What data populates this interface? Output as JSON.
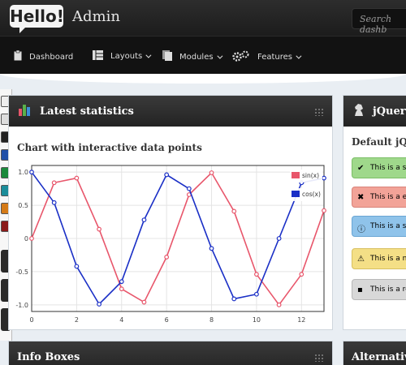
{
  "header": {
    "logo_text": "Hello!",
    "app_name": "Admin",
    "search_placeholder": "Search dashb"
  },
  "nav": {
    "items": [
      {
        "label": "Dashboard",
        "icon": "clipboard-icon"
      },
      {
        "label": "Layouts",
        "icon": "layout-icon"
      },
      {
        "label": "Modules",
        "icon": "pages-icon"
      },
      {
        "label": "Features",
        "icon": "gears-icon"
      }
    ]
  },
  "widgets": {
    "stats": {
      "title": "Latest statistics",
      "icon": "bar-chart-icon"
    },
    "jquery": {
      "title": "jQuery",
      "icon": "chess-knight-icon",
      "subtitle": "Default jQu"
    },
    "infoboxes": {
      "title": "Info Boxes"
    },
    "alternative": {
      "title": "Alternative w"
    }
  },
  "alerts": [
    {
      "text": "This is a su",
      "type": "success",
      "color": "#9fd88b"
    },
    {
      "text": "This is a er",
      "type": "error",
      "color": "#f2a398"
    },
    {
      "text": "This is a sy",
      "type": "info",
      "color": "#8fc3ea"
    },
    {
      "text": "This is a n",
      "type": "notice",
      "color": "#f4df86"
    },
    {
      "text": "This is a re",
      "type": "neutral",
      "color": "#d8d8d8"
    }
  ],
  "chart_data": {
    "type": "line",
    "title": "Chart with interactive data points",
    "xlim": [
      0,
      13
    ],
    "ylim": [
      -1.1,
      1.1
    ],
    "x_ticks": [
      "0",
      "2",
      "4",
      "6",
      "8",
      "10",
      "12"
    ],
    "y_ticks": [
      "1.0",
      "0.5",
      "0",
      "-0.5",
      "-1.0"
    ],
    "legend_position": "top-right",
    "grid": true,
    "x": [
      0,
      1,
      2,
      3,
      4,
      5,
      6,
      7,
      8,
      9,
      10,
      11,
      12,
      13
    ],
    "series": [
      {
        "name": "sin(x)",
        "color": "#e8566b",
        "values": [
          0.0,
          0.84,
          0.91,
          0.14,
          -0.76,
          -0.96,
          -0.28,
          0.66,
          0.99,
          0.41,
          -0.54,
          -1.0,
          -0.54,
          0.42
        ]
      },
      {
        "name": "cos(x)",
        "color": "#1a2fc6",
        "values": [
          1.0,
          0.54,
          -0.42,
          -0.99,
          -0.65,
          0.28,
          0.96,
          0.75,
          -0.15,
          -0.91,
          -0.84,
          0.0,
          0.84,
          0.91
        ]
      }
    ]
  }
}
